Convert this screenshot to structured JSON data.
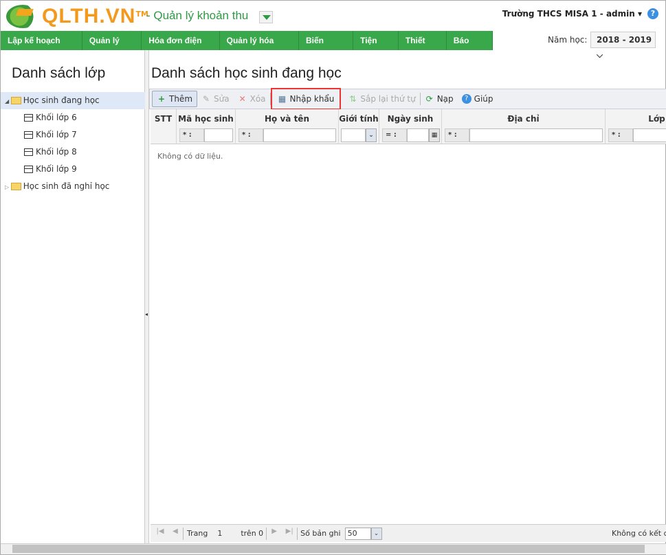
{
  "header": {
    "brand": "QLTH.VN",
    "tm": "TM",
    "app_title": "- Quản lý khoản thu",
    "user": "Trường THCS MISA 1 - admin ▾",
    "help": "?"
  },
  "nav": [
    "Lập kế hoạch thu",
    "Quản lý thu",
    "Hóa đơn điện tử",
    "Quản lý hóa đơn",
    "Biến động",
    "Tiện ích",
    "Thiết lập",
    "Báo cáo"
  ],
  "year": {
    "label": "Năm học:",
    "value": "2018 - 2019 ⌵"
  },
  "left": {
    "title": "Danh sách lớp",
    "tree": [
      {
        "label": "Học sinh đang học",
        "type": "folder",
        "expanded": true,
        "selected": true
      },
      {
        "label": "Khối lớp 6",
        "type": "leaf"
      },
      {
        "label": "Khối lớp 7",
        "type": "leaf"
      },
      {
        "label": "Khối lớp 8",
        "type": "leaf"
      },
      {
        "label": "Khối lớp 9",
        "type": "leaf"
      },
      {
        "label": "Học sinh đã nghỉ học",
        "type": "folder",
        "expanded": false
      }
    ]
  },
  "main": {
    "title": "Danh sách học sinh đang học",
    "toolbar": {
      "add": "Thêm",
      "edit": "Sửa",
      "delete": "Xóa",
      "import": "Nhập khẩu",
      "reorder": "Sắp lại thứ tự",
      "reload": "Nạp",
      "help": "Giúp"
    },
    "columns": [
      "STT",
      "Mã học sinh",
      "Họ và tên",
      "Giới tính",
      "Ngày sinh",
      "Địa chỉ",
      "Lớp"
    ],
    "filter_ops": {
      "text": "* :",
      "date": "= :"
    },
    "empty": "Không có dữ liệu.",
    "pager": {
      "page_label": "Trang",
      "page": "1",
      "of": "trên 0",
      "size_label": "Số bản ghi",
      "size": "50",
      "status": "Không có kết quả"
    }
  }
}
